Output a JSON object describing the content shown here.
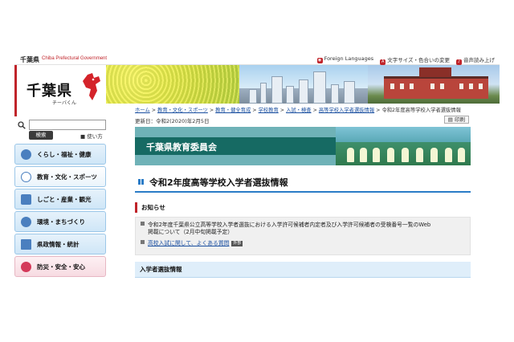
{
  "topbar": {
    "pref_name": "千葉県",
    "english_name": "Chiba Prefectural Government",
    "links": [
      {
        "label": "Foreign Languages",
        "icon": "globe-icon"
      },
      {
        "label": "文字サイズ・色合いの変更",
        "icon": "text-size-icon"
      },
      {
        "label": "音声読み上げ",
        "icon": "speaker-icon"
      }
    ]
  },
  "logo": {
    "title": "千葉県",
    "subtitle": "チーバくん",
    "brand_color": "#c0242a"
  },
  "search": {
    "placeholder": "",
    "button_label": "検索",
    "usage_label": "使い方"
  },
  "nav": {
    "items": [
      {
        "label": "くらし・福祉・健康",
        "icon": "house-icon"
      },
      {
        "label": "教育・文化・スポーツ",
        "icon": "pencil-icon"
      },
      {
        "label": "しごと・産業・観光",
        "icon": "briefcase-icon"
      },
      {
        "label": "環境・まちづくり",
        "icon": "tree-icon"
      },
      {
        "label": "県政情報・統計",
        "icon": "building-icon"
      },
      {
        "label": "防災・安全・安心",
        "icon": "heart-icon"
      }
    ]
  },
  "breadcrumb": {
    "items": [
      "ホーム",
      "教育・文化・スポーツ",
      "教育・健全育成",
      "学校教育",
      "入試・検査",
      "高等学校入学者選抜情報"
    ],
    "current": "令和2年度高等学校入学者選抜情報",
    "separator": ">"
  },
  "meta": {
    "updated": "更新日：令和2(2020)年2月5日",
    "print_label": "印刷"
  },
  "board": {
    "title": "千葉県教育委員会"
  },
  "page": {
    "title": "令和2年度高等学校入学者選抜情報"
  },
  "notice": {
    "heading": "お知らせ",
    "items": [
      {
        "line1": "令和2年度千葉県公立高等学校入学者選抜における入学許可候補者内定者及び入学許可候補者の受検番号一覧のWeb",
        "line2": "掲載について（2月中旬掲載予定）"
      },
      {
        "link": "高校入試に関して、よくある質問",
        "tag": "外部"
      }
    ]
  },
  "section": {
    "heading": "入学者選抜情報"
  }
}
